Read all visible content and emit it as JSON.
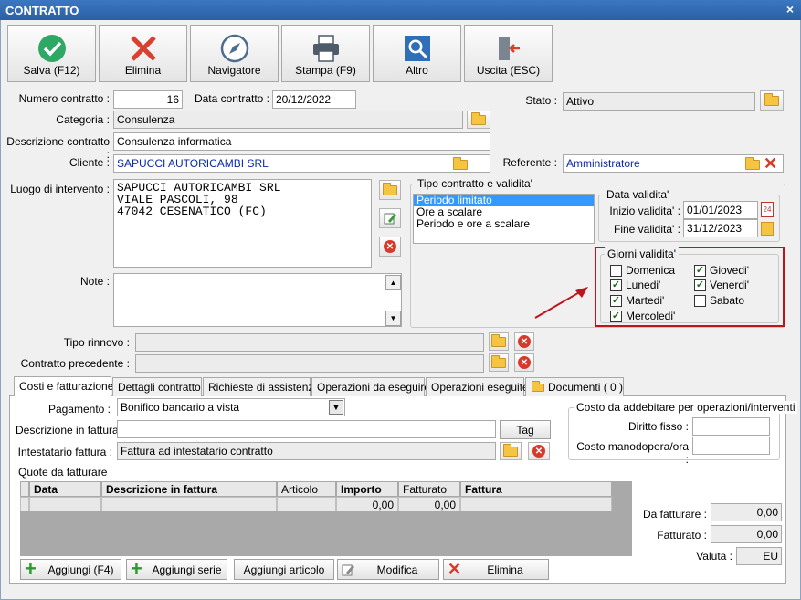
{
  "window": {
    "title": "CONTRATTO",
    "close": "×"
  },
  "toolbar": {
    "save": "Salva (F12)",
    "delete": "Elimina",
    "navigator": "Navigatore",
    "print": "Stampa (F9)",
    "other": "Altro",
    "exit": "Uscita (ESC)"
  },
  "header": {
    "numero_label": "Numero contratto :",
    "numero_value": "16",
    "data_label": "Data contratto :",
    "data_value": "20/12/2022",
    "stato_label": "Stato :",
    "stato_value": "Attivo",
    "categoria_label": "Categoria :",
    "categoria_value": "Consulenza",
    "descrizione_label": "Descrizione contratto :",
    "descrizione_value": "Consulenza informatica",
    "cliente_label": "Cliente :",
    "cliente_value": "SAPUCCI AUTORICAMBI SRL",
    "referente_label": "Referente :",
    "referente_value": "Amministratore",
    "luogo_label": "Luogo di intervento :",
    "luogo_value": "SAPUCCI AUTORICAMBI SRL\nVIALE PASCOLI, 98\n47042 CESENATICO (FC)",
    "note_label": "Note :",
    "note_value": "",
    "rinnovo_label": "Tipo rinnovo :",
    "rinnovo_value": "",
    "precedente_label": "Contratto precedente :",
    "precedente_value": ""
  },
  "tipo_contratto": {
    "title": "Tipo contratto e validita'",
    "options": [
      "Periodo limitato",
      "Ore a scalare",
      "Periodo e ore a scalare"
    ],
    "selected": "Periodo limitato"
  },
  "data_validita": {
    "title": "Data validita'",
    "inizio_label": "Inizio validita' :",
    "inizio_value": "01/01/2023",
    "fine_label": "Fine validita' :",
    "fine_value": "31/12/2023",
    "calendar_day": "24"
  },
  "giorni": {
    "title": "Giorni validita'",
    "days": [
      {
        "label": "Domenica",
        "checked": false
      },
      {
        "label": "Lunedi'",
        "checked": true
      },
      {
        "label": "Martedi'",
        "checked": true
      },
      {
        "label": "Mercoledi'",
        "checked": true
      },
      {
        "label": "Giovedi'",
        "checked": true
      },
      {
        "label": "Venerdi'",
        "checked": true
      },
      {
        "label": "Sabato",
        "checked": false
      }
    ]
  },
  "tabs": [
    {
      "label": "Costi e fatturazione",
      "active": true
    },
    {
      "label": "Dettagli contratto"
    },
    {
      "label": "Richieste di assistenza"
    },
    {
      "label": "Operazioni da eseguire"
    },
    {
      "label": "Operazioni eseguite"
    },
    {
      "label": "Documenti ( 0 )"
    }
  ],
  "billing": {
    "pagamento_label": "Pagamento :",
    "pagamento_value": "Bonifico bancario a vista",
    "descr_fatt_label": "Descrizione in fattura",
    "descr_fatt_value": "",
    "tag_button": "Tag",
    "intestatario_label": "Intestatario fattura :",
    "intestatario_value": "Fattura ad intestatario contratto",
    "quote_label": "Quote da fatturare"
  },
  "costo": {
    "title": "Costo da addebitare per operazioni/interventi",
    "diritto_label": "Diritto fisso :",
    "diritto_value": "",
    "manodopera_label": "Costo manodopera/ora :",
    "manodopera_value": ""
  },
  "grid": {
    "columns": [
      "Data",
      "Descrizione in fattura",
      "Articolo",
      "Importo",
      "Fatturato",
      "Fattura"
    ],
    "totals": {
      "importo": "0,00",
      "fatturato": "0,00"
    }
  },
  "summary": {
    "da_fatturare_label": "Da fatturare :",
    "da_fatturare_value": "0,00",
    "fatturato_label": "Fatturato :",
    "fatturato_value": "0,00",
    "valuta_label": "Valuta :",
    "valuta_value": "EU"
  },
  "bottom_buttons": {
    "aggiungi": "Aggiungi (F4)",
    "aggiungi_serie": "Aggiungi serie",
    "aggiungi_articolo": "Aggiungi articolo",
    "modifica": "Modifica",
    "elimina": "Elimina"
  },
  "colors": {
    "accent": "#2b5fa3",
    "highlight": "#c0141c",
    "selection": "#3399ff"
  }
}
